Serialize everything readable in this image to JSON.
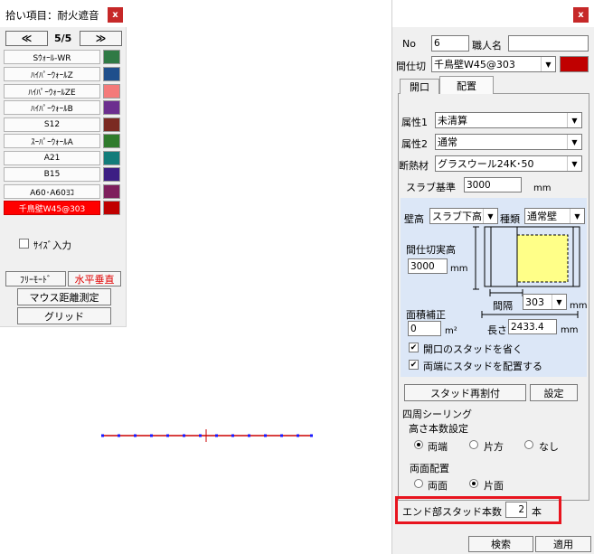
{
  "left_panel": {
    "title": "拾い項目：耐火遮音",
    "close": "x",
    "nav_prev": "≪",
    "page": "5/5",
    "nav_next": "≫",
    "items": [
      {
        "label": "Sｳｫｰﾙ-WR",
        "color": "#2f7a45"
      },
      {
        "label": "ﾊｲﾊﾟｰｳｫｰﾙZ",
        "color": "#1f4f8c"
      },
      {
        "label": "ﾊｲﾊﾟｰｳｫｰﾙZE",
        "color": "#f47a7a"
      },
      {
        "label": "ﾊｲﾊﾟｰｳｫｰﾙB",
        "color": "#6c2f8f"
      },
      {
        "label": "S12",
        "color": "#7b2a22"
      },
      {
        "label": "ｽｰﾊﾟｰｳｫｰﾙA",
        "color": "#2f7b2c"
      },
      {
        "label": "A21",
        "color": "#127c7a"
      },
      {
        "label": "B15",
        "color": "#3c1e84"
      },
      {
        "label": "A60･A60ﾖｺ",
        "color": "#7e1f5c"
      },
      {
        "label": "千鳥壁W45@303",
        "color": "#c00000",
        "selected": true
      }
    ],
    "size_input_label": "ｻｲｽﾞ入力",
    "free_mode": "ﾌﾘｰﾓｰﾄﾞ",
    "horiz_vert": "水平垂直",
    "mouse_measure": "マウス距離測定",
    "grid": "グリッド"
  },
  "right_panel": {
    "close": "x",
    "no_label": "No",
    "no_value": "6",
    "worker_label": "職人名",
    "worker_value": "",
    "partition_label": "間仕切",
    "partition_value": "千鳥壁W45@303",
    "partition_color": "#c00000",
    "tabs": [
      "開口",
      "配置"
    ],
    "attr1_label": "属性1",
    "attr1_value": "未清算",
    "attr2_label": "属性2",
    "attr2_value": "通常",
    "insulation_label": "断熱材",
    "insulation_value": "グラスウール24K･50",
    "slab_label": "スラブ基準",
    "slab_value": "3000",
    "slab_unit": "mm",
    "wall_height_label": "壁高",
    "wall_height_value": "スラブ下高",
    "type_label": "種類",
    "type_value": "通常壁",
    "actual_height_label": "間仕切実高",
    "actual_height_value": "3000",
    "actual_height_unit": "mm",
    "interval_label": "間隔",
    "interval_value": "303",
    "interval_unit": "mm",
    "area_corr_label": "面積補正",
    "area_corr_value": "0",
    "area_unit": "m²",
    "length_label": "長さ",
    "length_value": "2433.4",
    "length_unit": "mm",
    "omit_opening_studs": "開口のスタッドを省く",
    "studs_both_ends": "両端にスタッドを配置する",
    "stud_reassign": "スタッド再割付",
    "settings": "設定",
    "ceiling_section": "四周シーリング",
    "height_count_label": "高さ本数設定",
    "opt_both_ends": "両端",
    "opt_one_side": "片方",
    "opt_none": "なし",
    "both_sides_label": "両面配置",
    "opt_both_faces": "両面",
    "opt_one_face": "片面",
    "end_studs_label": "エンド部スタッド本数",
    "end_studs_value": "2",
    "end_studs_unit": "本",
    "search": "検索",
    "apply": "適用"
  },
  "canvas": {
    "wall_color": "#cc0000",
    "stud_color": "#1a1aff"
  }
}
